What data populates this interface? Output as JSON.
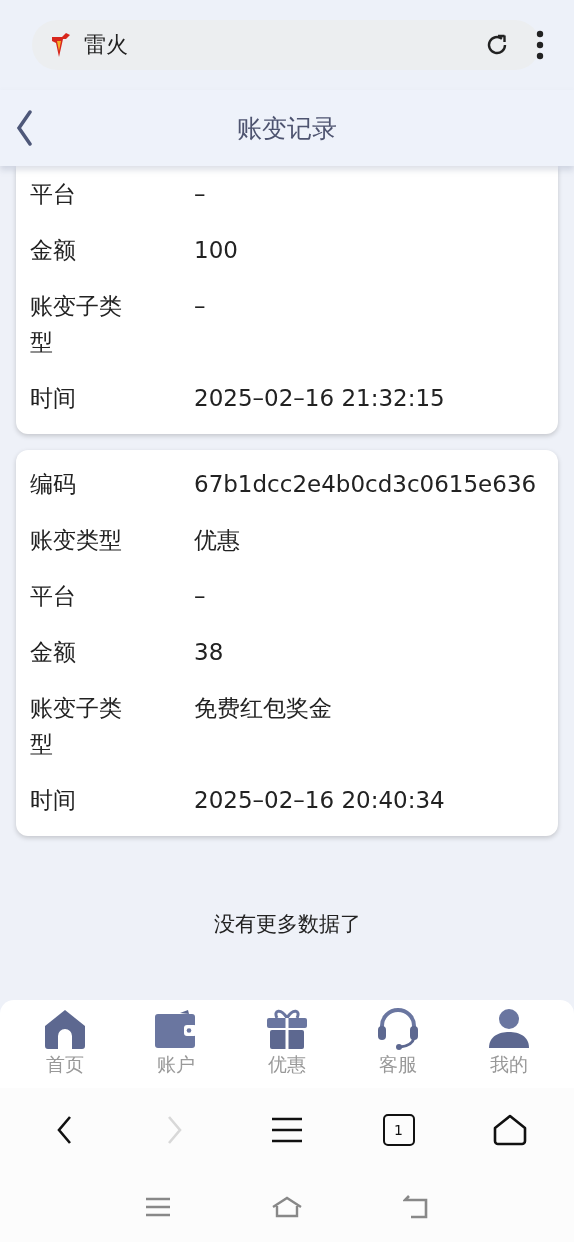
{
  "address_bar": {
    "site_name": "雷火"
  },
  "header": {
    "title": "账变记录"
  },
  "records": [
    {
      "fields": [
        {
          "label": "平台",
          "value": "–"
        },
        {
          "label": "金额",
          "value": "100"
        },
        {
          "label": "账变子类型",
          "value": "–"
        },
        {
          "label": "时间",
          "value": "2025–02–16 21:32:15"
        }
      ]
    },
    {
      "fields": [
        {
          "label": "编码",
          "value": "67b1dcc2e4b0cd3c0615e636"
        },
        {
          "label": "账变类型",
          "value": "优惠"
        },
        {
          "label": "平台",
          "value": "–"
        },
        {
          "label": "金额",
          "value": "38"
        },
        {
          "label": "账变子类型",
          "value": "免费红包奖金"
        },
        {
          "label": "时间",
          "value": "2025–02–16 20:40:34"
        }
      ]
    }
  ],
  "end_message": "没有更多数据了",
  "tab_bar": [
    {
      "kind": "home",
      "label": "首页"
    },
    {
      "kind": "wallet",
      "label": "账户"
    },
    {
      "kind": "gift",
      "label": "优惠"
    },
    {
      "kind": "headset",
      "label": "客服"
    },
    {
      "kind": "user",
      "label": "我的"
    }
  ],
  "browser_nav": [
    {
      "kind": "back",
      "disabled": false
    },
    {
      "kind": "forward",
      "disabled": true
    },
    {
      "kind": "menu",
      "disabled": false
    },
    {
      "kind": "tabs",
      "disabled": false,
      "count": "1"
    },
    {
      "kind": "home",
      "disabled": false
    }
  ]
}
